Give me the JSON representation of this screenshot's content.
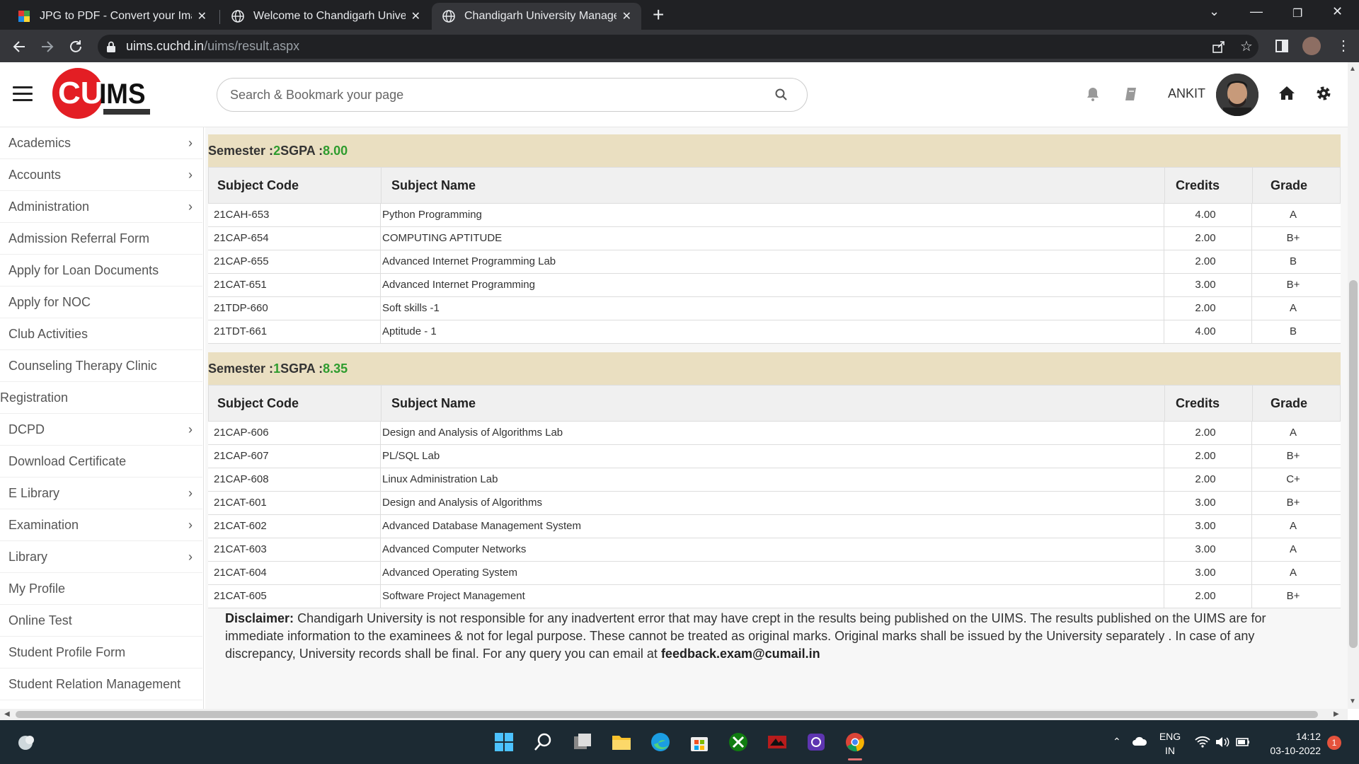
{
  "browser": {
    "tabs": [
      {
        "title": "JPG to PDF - Convert your Images",
        "close": "✕"
      },
      {
        "title": "Welcome to Chandigarh University",
        "close": "✕"
      },
      {
        "title": "Chandigarh University Management",
        "close": "✕"
      }
    ],
    "new_tab": "+",
    "url_host": "uims.cuchd.in",
    "url_path": "/uims/result.aspx"
  },
  "header": {
    "logo_text": "CUIMS",
    "search_placeholder": "Search & Bookmark your page",
    "username": "ANKIT"
  },
  "sidebar": {
    "items": [
      {
        "label": "Academics",
        "chevron": true
      },
      {
        "label": "Accounts",
        "chevron": true
      },
      {
        "label": "Administration",
        "chevron": true
      },
      {
        "label": "Admission Referral Form",
        "chevron": false
      },
      {
        "label": "Apply for Loan Documents",
        "chevron": false
      },
      {
        "label": "Apply for NOC",
        "chevron": false
      },
      {
        "label": "Club Activities",
        "chevron": false
      },
      {
        "label": "Counseling Therapy Clinic",
        "chevron": false
      },
      {
        "label": "Registration",
        "chevron": false
      },
      {
        "label": "DCPD",
        "chevron": true
      },
      {
        "label": "Download Certificate",
        "chevron": false
      },
      {
        "label": "E Library",
        "chevron": true
      },
      {
        "label": "Examination",
        "chevron": true
      },
      {
        "label": "Library",
        "chevron": true
      },
      {
        "label": "My Profile",
        "chevron": false
      },
      {
        "label": "Online Test",
        "chevron": false
      },
      {
        "label": "Student Profile Form",
        "chevron": false
      },
      {
        "label": "Student Relation Management",
        "chevron": false
      }
    ]
  },
  "results": {
    "columns": [
      "Subject Code",
      "Subject Name",
      "Credits",
      "Grade"
    ],
    "semesters": [
      {
        "label": "Semester : ",
        "number": "2",
        "sgpa_label": " SGPA : ",
        "sgpa": "8.00",
        "rows": [
          [
            "21CAH-653",
            "Python Programming",
            "4.00",
            "A"
          ],
          [
            "21CAP-654",
            "COMPUTING APTITUDE",
            "2.00",
            "B+"
          ],
          [
            "21CAP-655",
            "Advanced Internet Programming Lab",
            "2.00",
            "B"
          ],
          [
            "21CAT-651",
            "Advanced Internet Programming",
            "3.00",
            "B+"
          ],
          [
            "21TDP-660",
            "Soft skills -1",
            "2.00",
            "A"
          ],
          [
            "21TDT-661",
            "Aptitude - 1",
            "4.00",
            "B"
          ]
        ]
      },
      {
        "label": "Semester : ",
        "number": "1",
        "sgpa_label": " SGPA : ",
        "sgpa": "8.35",
        "rows": [
          [
            "21CAP-606",
            "Design and Analysis of Algorithms Lab",
            "2.00",
            "A"
          ],
          [
            "21CAP-607",
            "PL/SQL Lab",
            "2.00",
            "B+"
          ],
          [
            "21CAP-608",
            "Linux Administration Lab",
            "2.00",
            "C+"
          ],
          [
            "21CAT-601",
            "Design and Analysis of Algorithms",
            "3.00",
            "B+"
          ],
          [
            "21CAT-602",
            "Advanced Database Management System",
            "3.00",
            "A"
          ],
          [
            "21CAT-603",
            "Advanced Computer Networks",
            "3.00",
            "A"
          ],
          [
            "21CAT-604",
            "Advanced Operating System",
            "3.00",
            "A"
          ],
          [
            "21CAT-605",
            "Software Project Management",
            "2.00",
            "B+"
          ]
        ]
      }
    ],
    "disclaimer_label": "Disclaimer:",
    "disclaimer_text": " Chandigarh University is not responsible for any inadvertent error that may have crept in the results being published on the UIMS. The results published on the UIMS are for immediate information to the examinees & not for legal purpose. These cannot be treated as original marks. Original marks shall be issued by the University separately . In case of any discrepancy, University records shall be final. For any query you can email at ",
    "disclaimer_email": "feedback.exam@cumail.in"
  },
  "taskbar": {
    "lang_line1": "ENG",
    "lang_line2": "IN",
    "time": "14:12",
    "date": "03-10-2022",
    "notification_count": "1"
  },
  "colors": {
    "semester_band": "#eadfc1",
    "sgpa_green": "#2e9c2e",
    "logo_red": "#e31e24"
  }
}
